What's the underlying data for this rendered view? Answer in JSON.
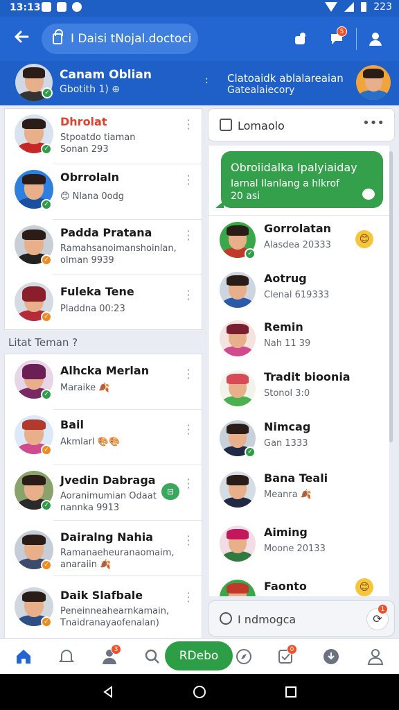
{
  "statusbar": {
    "time": "13:13",
    "battery": "223"
  },
  "topbar": {
    "search_text": "I Daisi tNojal.doctoci",
    "badge_count": "5"
  },
  "profile": {
    "name": "Canam Oblian",
    "sub": "Gbotith 1) ⊕",
    "right_line1": "Clatoaidk ablalareaian",
    "right_line2": "Gatealaiecory"
  },
  "left_top": [
    {
      "name": "Dhrolat",
      "msg": [
        "Stpoatdo tiaman",
        "Sonan 293"
      ],
      "status": "green",
      "highlight": true
    },
    {
      "name": "Obrrolaln",
      "msg": [
        "😊 Nlana 0odg"
      ],
      "status": "green"
    },
    {
      "name": "Padda Pratana",
      "msg": [
        "Ramahsanoimanshoinlan,",
        "olman 9939"
      ],
      "status": "orange"
    },
    {
      "name": "Fuleka Tene",
      "msg": [
        "Pladdna 00:23"
      ],
      "status": "orange"
    }
  ],
  "section_label": "Litat Teman ?",
  "left_bottom": [
    {
      "name": "Alhcka Merlan",
      "msg": [
        "Maraike 🍂"
      ],
      "status": "green"
    },
    {
      "name": "Bail",
      "msg": [
        "Akmlarl 🎨🎨"
      ],
      "status": "orange"
    },
    {
      "name": "Jvedin Dabraga",
      "msg": [
        "Aoranimumian Odaat",
        "nannka 9913"
      ],
      "status": "green",
      "chip": "⊟"
    },
    {
      "name": "Dairalng Nahia",
      "msg": [
        "Ramanaeheuranaomaim,",
        "anaraiin 🍂"
      ],
      "status": "orange"
    },
    {
      "name": "Daik Slafbale",
      "msg": [
        "Peneinneahearnkamain,",
        "Tnaidranayaofenalan)"
      ],
      "status": "orange"
    }
  ],
  "right_header": {
    "title": "Lomaolo",
    "more": "•••"
  },
  "bubble": {
    "line1": "Obroiidalka Ipalyiaiday",
    "line2": "Iarnal Ilanlang a hlkrof",
    "line3": "20 asi"
  },
  "right_list": [
    {
      "name": "Gorrolatan",
      "msg": "Alasdea 20333",
      "emoji": "😊"
    },
    {
      "name": "Aotrug",
      "msg": "Clenal 619333"
    },
    {
      "name": "Remin",
      "msg": "Nah 11 39"
    },
    {
      "name": "Tradit bioonia",
      "msg": "Stonol 3:0"
    },
    {
      "name": "Nimcag",
      "msg": "Gan 1333"
    },
    {
      "name": "Bana Teali",
      "msg": "Meanra 🍂"
    },
    {
      "name": "Aiming",
      "msg": "Moone 20133"
    },
    {
      "name": "Faonto",
      "msg": "",
      "emoji": "😊"
    }
  ],
  "compose": {
    "placeholder": "I ndmogca",
    "badge": "1"
  },
  "bottom_nav": {
    "center_label": "RDebo",
    "badge_a": "3",
    "badge_b": "0"
  }
}
